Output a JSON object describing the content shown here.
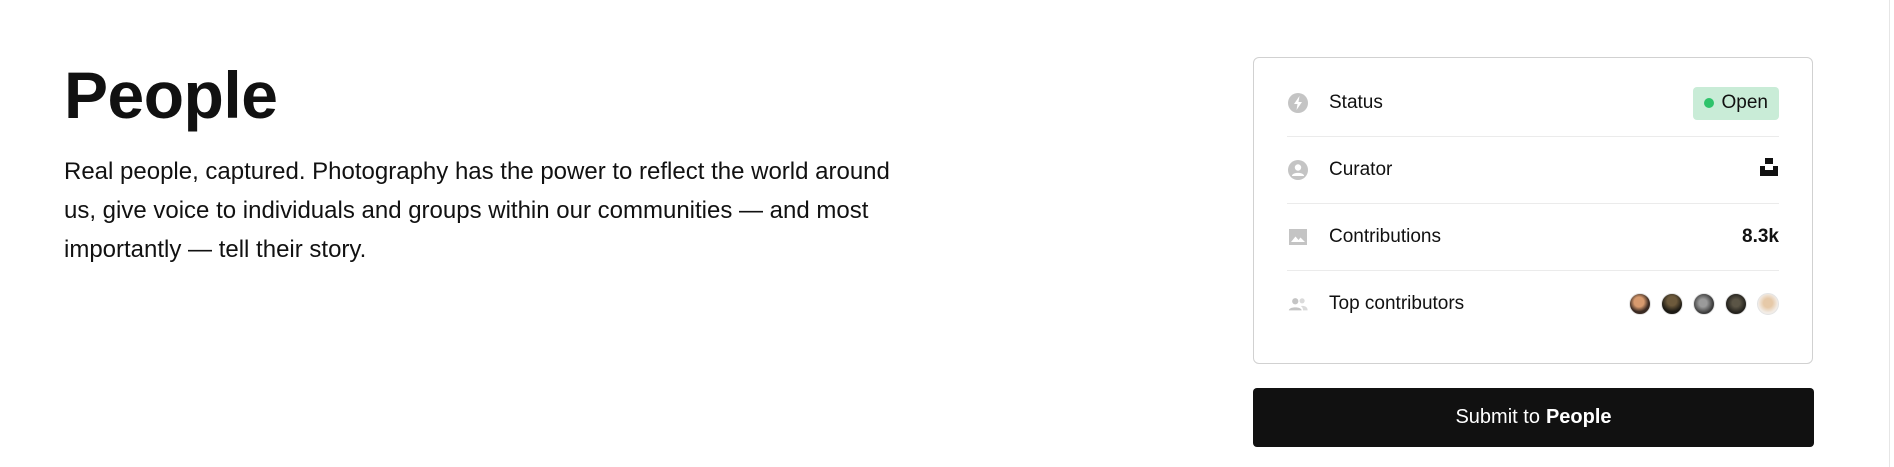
{
  "topic": {
    "title": "People",
    "description": "Real people, captured. Photography has the power to reflect the world around us, give voice to individuals and groups within our communities — and most importantly — tell their story."
  },
  "info": {
    "status_label": "Status",
    "status_value": "Open",
    "curator_label": "Curator",
    "curator_icon": "unsplash-logo",
    "contributions_label": "Contributions",
    "contributions_value": "8.3k",
    "top_contributors_label": "Top contributors",
    "top_contributors_count": 5
  },
  "submit": {
    "prefix": "Submit to",
    "topic": "People"
  },
  "colors": {
    "status_badge_bg": "#c9ecd7",
    "status_dot": "#2ec36b",
    "button_bg": "#111111",
    "icon_gray": "#c4c4c4"
  },
  "icons": {
    "status": "bolt-circle-icon",
    "curator": "person-circle-icon",
    "contributions": "image-icon",
    "top_contributors": "people-icon"
  }
}
